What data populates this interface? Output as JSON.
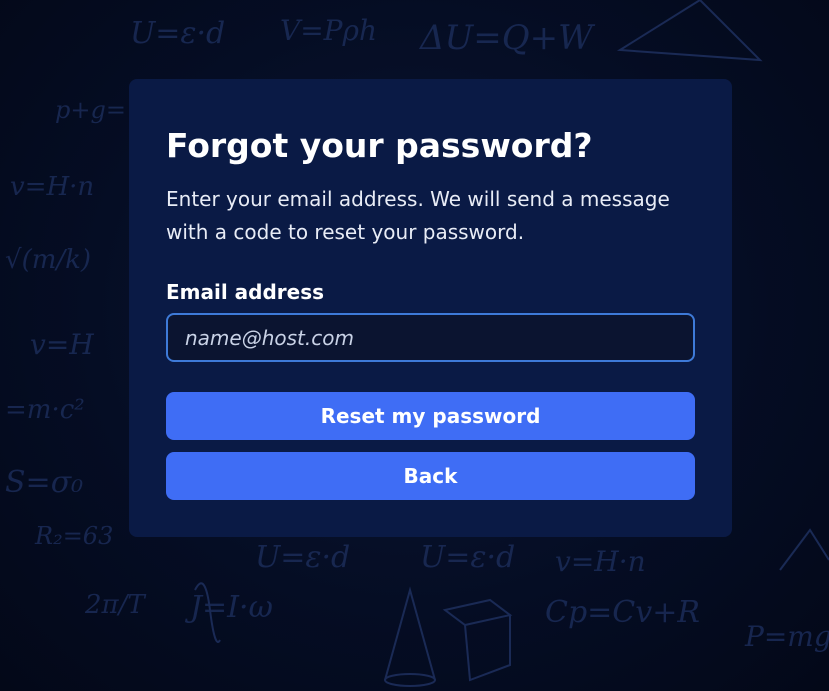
{
  "background": {
    "formulas": [
      "U=ε·d",
      "V=Pρh",
      "ΔU=Q+W",
      "p+g=",
      "v=H·n",
      "√(m/k)",
      "v=H",
      "=m·c²",
      "S=σ₀",
      "R₂=63",
      "U=ε·d",
      "U=ε·d",
      "v=H·n",
      "2π/T",
      "J=I·ω",
      "Cp=Cv+R",
      "P=mg"
    ]
  },
  "form": {
    "title": "Forgot your password?",
    "description": "Enter your email address. We will send a message with a code to reset your password.",
    "email_label": "Email address",
    "email_placeholder": "name@host.com",
    "email_value": "",
    "reset_label": "Reset my password",
    "back_label": "Back"
  },
  "colors": {
    "page_background": "#040b1f",
    "card_background": "#0a1a45",
    "button_background": "#3f6df5",
    "input_border": "#3e7ad8"
  }
}
